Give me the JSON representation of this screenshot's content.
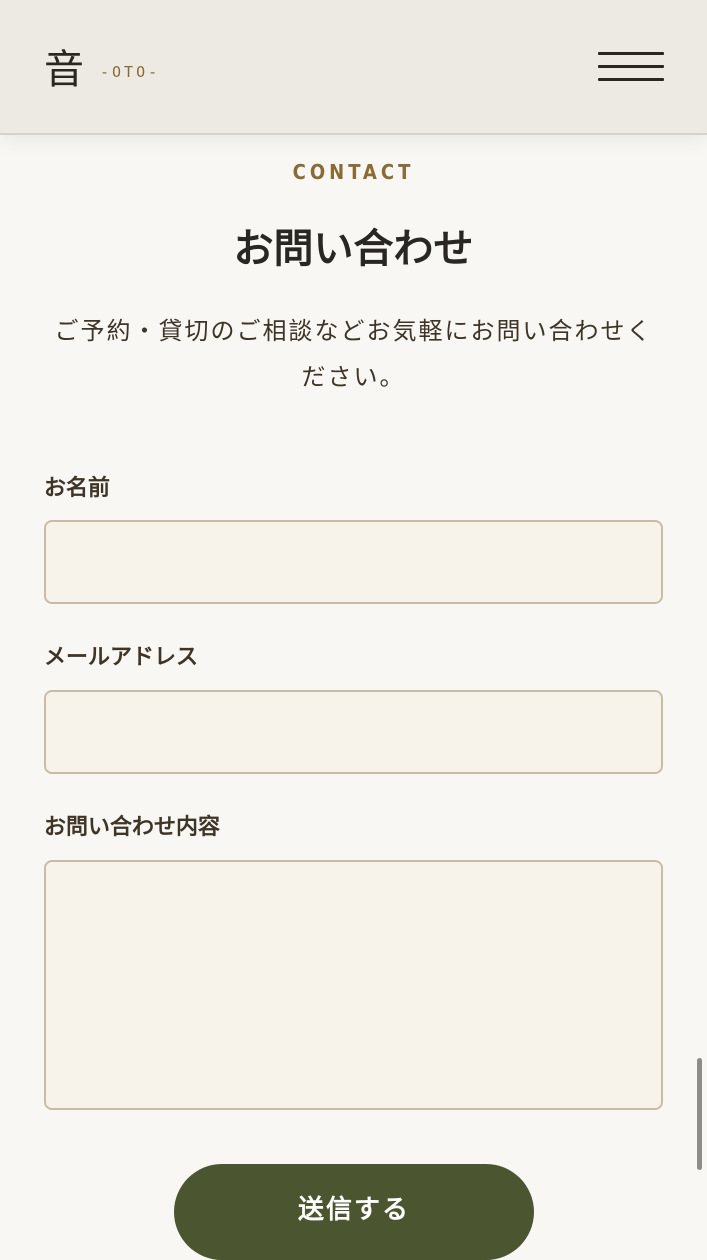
{
  "header": {
    "logo_kanji": "音",
    "logo_sub": "-OTO-",
    "menu_icon": "hamburger-menu-icon"
  },
  "section": {
    "eyebrow": "CONTACT",
    "title": "お問い合わせ",
    "lead": "ご予約・貸切のご相談などお気軽にお問い合わせください。"
  },
  "form": {
    "name": {
      "label": "お名前",
      "value": "",
      "placeholder": ""
    },
    "email": {
      "label": "メールアドレス",
      "value": "",
      "placeholder": ""
    },
    "message": {
      "label": "お問い合わせ内容",
      "value": "",
      "placeholder": ""
    },
    "submit_label": "送信する"
  },
  "colors": {
    "background": "#f8f7f3",
    "header_background": "#eceae3",
    "accent_gold": "#8a6a35",
    "input_background": "#f7f3eb",
    "input_border": "#c9bca6",
    "button_olive": "#4b5530"
  }
}
